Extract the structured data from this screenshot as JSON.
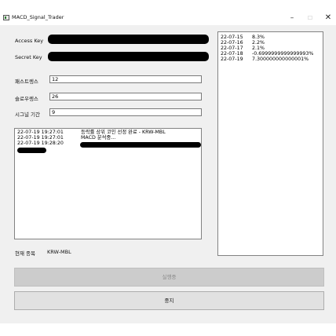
{
  "window": {
    "title": "MACD_Signal_Trader",
    "min_glyph": "–",
    "max_glyph": "☐",
    "close_glyph": "✕"
  },
  "form": {
    "access_key_label": "Access Key",
    "secret_key_label": "Secret Key",
    "fast_label": "패스트렝스",
    "fast_value": "12",
    "slow_label": "슬로우렝스",
    "slow_value": "26",
    "signal_label": "시그널 기간",
    "signal_value": "9"
  },
  "log": {
    "entries": [
      {
        "time": "22-07-19 19:27:01",
        "message": "등락률 상위 코인 선정 완료 - KRW-MBL"
      },
      {
        "time": "22-07-19 19:27:01",
        "message": "MACD 분석중..."
      },
      {
        "time": "22-07-19 19:28:20",
        "message": ""
      }
    ]
  },
  "side_list": {
    "rows": [
      {
        "date": "22-07-15",
        "value": "8.3%"
      },
      {
        "date": "22-07-16",
        "value": "2.2%"
      },
      {
        "date": "22-07-17",
        "value": "2.1%"
      },
      {
        "date": "22-07-18",
        "value": "-0.6999999999999993%"
      },
      {
        "date": "22-07-19",
        "value": "7.300000000000001%"
      }
    ]
  },
  "current": {
    "label": "현재 종목",
    "value": "KRW-MBL"
  },
  "buttons": {
    "run_label": "실행중",
    "stop_label": "중지"
  },
  "colors": {
    "client_bg": "#f0f0f0",
    "button_disabled": "#cccccc",
    "button_normal": "#e1e1e1",
    "redaction": "#000000"
  }
}
